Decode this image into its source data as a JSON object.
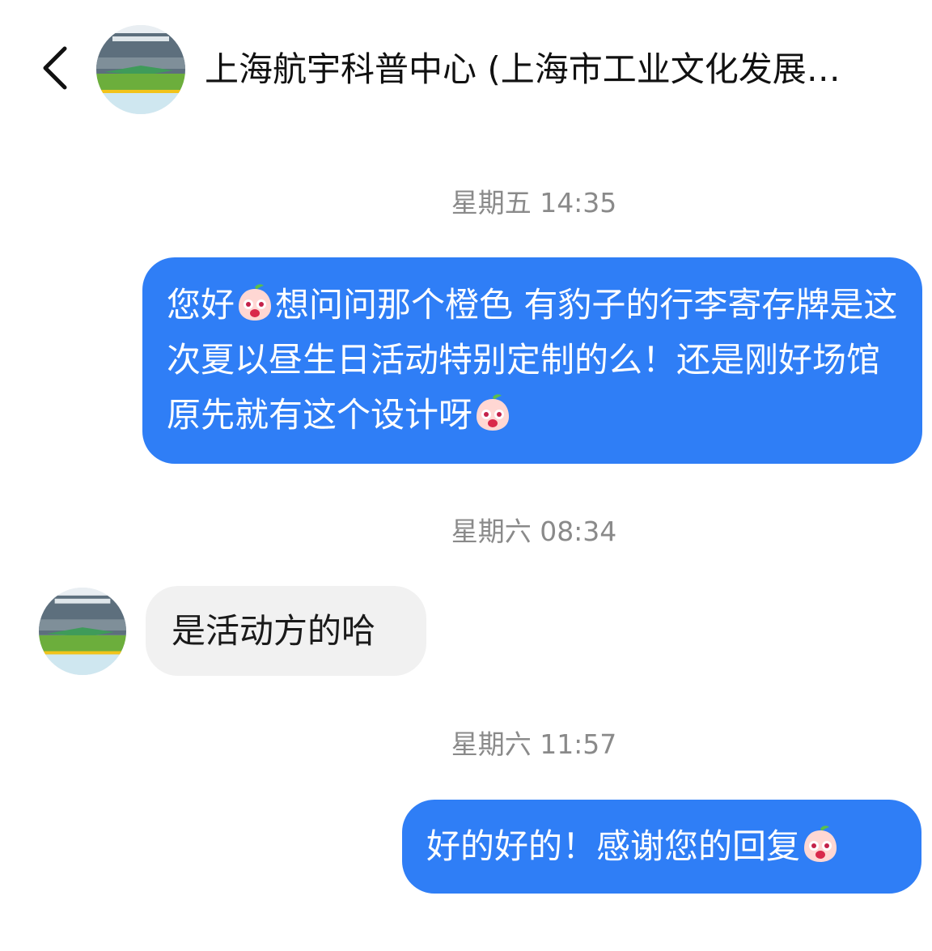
{
  "header": {
    "back_icon": "chevron-left-icon",
    "title": "上海航宇科普中心 (上海市工业文化发展…"
  },
  "messages": [
    {
      "timestamp": "星期五 14:35",
      "direction": "outgoing",
      "parts": [
        "您好",
        "想问问那个橙色 有豹子的行李寄存牌是这次夏以昼生日活动特别定制的么！还是刚好场馆原先就有这个设计呀"
      ]
    },
    {
      "timestamp": "星期六 08:34",
      "direction": "incoming",
      "text": "是活动方的哈"
    },
    {
      "timestamp": "星期六 11:57",
      "direction": "outgoing",
      "text": "好的好的！感谢您的回复"
    }
  ],
  "emoji_name": "peach-face-emoji",
  "colors": {
    "outgoing_bubble": "#2f7ef6",
    "incoming_bubble": "#f1f1f1",
    "timestamp_text": "#8a8a8a"
  }
}
